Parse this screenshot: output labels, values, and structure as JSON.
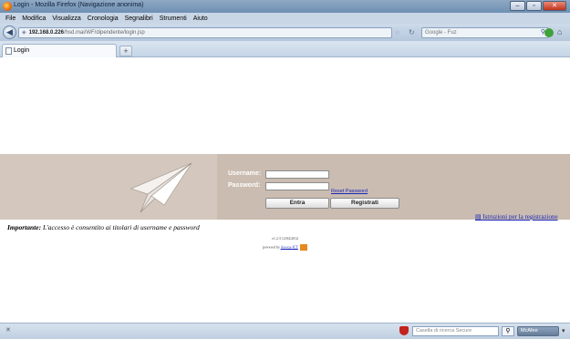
{
  "window": {
    "title": "Login - Mozilla Firefox (Navigazione anonima)",
    "minimize": "–",
    "maximize": "▫",
    "close": "✕"
  },
  "menu": [
    "File",
    "Modifica",
    "Visualizza",
    "Cronologia",
    "Segnalibri",
    "Strumenti",
    "Aiuto"
  ],
  "navbar": {
    "url_host": "192.168.0.226",
    "url_path": "/hsd.mai/WF/dipendente/login.jsp",
    "search_placeholder": "Google - Fuz"
  },
  "tabs": [
    {
      "label": "Login"
    }
  ],
  "login": {
    "username_label": "Username:",
    "password_label": "Password:",
    "username_value": "",
    "password_value": "",
    "reset_link": "Reset Password",
    "enter_button": "Entra",
    "register_button": "Registrati",
    "instructions_link": "Istruzioni per la registrazione"
  },
  "notice": {
    "bold": "Importante:",
    "text": " L'accesso è consentito ai titolari di username e password"
  },
  "footer": {
    "version": "v1.2.3 12/04/2012",
    "powered_prefix": "powered by ",
    "powered_link": "Assoca-ICT"
  },
  "statusbar": {
    "close_glyph": "✕",
    "search_placeholder": "Casella di ricerca Secure",
    "badge": "McAfee"
  },
  "colors": {
    "login_band": "#cabcb1",
    "link": "#1a27b8"
  }
}
